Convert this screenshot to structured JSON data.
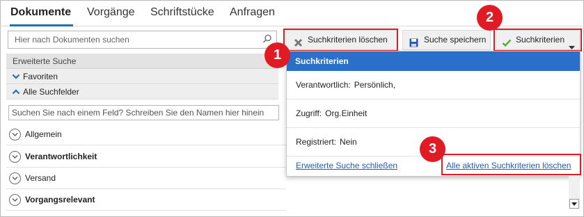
{
  "tabs": [
    {
      "label": "Dokumente",
      "active": true
    },
    {
      "label": "Vorgänge",
      "active": false
    },
    {
      "label": "Schriftstücke",
      "active": false
    },
    {
      "label": "Anfragen",
      "active": false
    }
  ],
  "search": {
    "placeholder": "Hier nach Dokumenten suchen",
    "icon": "search-icon"
  },
  "left_panel": {
    "advanced_search_label": "Erweiterte Suche",
    "favorites_label": "Favoriten",
    "all_fields_label": "Alle Suchfelder",
    "field_search_placeholder": "Suchen Sie nach einem Feld? Schreiben Sie den Namen hier hinein",
    "sections": [
      {
        "label": "Allgemein",
        "bold": false
      },
      {
        "label": "Verantwortlichkeit",
        "bold": true
      },
      {
        "label": "Versand",
        "bold": false
      },
      {
        "label": "Vorgangsrelevant",
        "bold": true
      }
    ]
  },
  "toolbar": {
    "clear_label": "Suchkriterien löschen",
    "save_label": "Suche speichern",
    "criteria_label": "Suchkriterien"
  },
  "dropdown": {
    "header": "Suchkriterien",
    "items": [
      {
        "key": "Verantwortlich:",
        "value": "Persönlich,"
      },
      {
        "key": "Zugriff:",
        "value": "Org.Einheit"
      },
      {
        "key": "Registriert:",
        "value": "Nein"
      }
    ],
    "close_link": "Erweiterte Suche schließen",
    "clear_all_link": "Alle aktiven Suchkriterien löschen"
  },
  "callouts": [
    "1",
    "2",
    "3"
  ],
  "colors": {
    "accent": "#1f6fb3",
    "highlight": "#e01b24",
    "dropdown_header": "#2a6fc9",
    "link": "#1f5fb0"
  }
}
